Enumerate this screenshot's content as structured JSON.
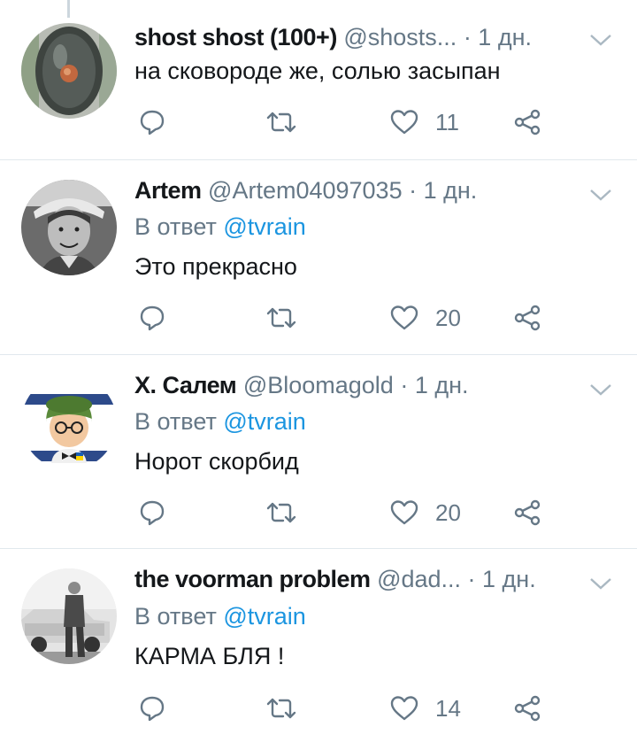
{
  "tweets": [
    {
      "name": "shost shost (100+)",
      "handle": "@shosts...",
      "time": "· 1 дн.",
      "reply_prefix": "",
      "reply_mention": "",
      "text": "на сковороде же, солью засыпан",
      "reply_count": "",
      "retweet_count": "",
      "like_count": "11"
    },
    {
      "name": "Artem",
      "handle": "@Artem04097035",
      "time": "· 1 дн.",
      "reply_prefix": "В ответ ",
      "reply_mention": "@tvrain",
      "text": "Это прекрасно",
      "reply_count": "",
      "retweet_count": "",
      "like_count": "20"
    },
    {
      "name": "Х. Салем",
      "handle": "@Bloomagold",
      "time": "· 1 дн.",
      "reply_prefix": "В ответ ",
      "reply_mention": "@tvrain",
      "text": "Норот скорбид",
      "reply_count": "",
      "retweet_count": "",
      "like_count": "20"
    },
    {
      "name": "the voorman problem",
      "handle": "@dad...",
      "time": "· 1 дн.",
      "reply_prefix": "В ответ ",
      "reply_mention": "@tvrain",
      "text": "КАРМА БЛЯ !",
      "reply_count": "",
      "retweet_count": "",
      "like_count": "14"
    }
  ],
  "colors": {
    "text": "#14171a",
    "secondary": "#657786",
    "link": "#1b95e0",
    "divider": "#e1e8ed"
  },
  "icons": [
    "reply-icon",
    "retweet-icon",
    "like-icon",
    "share-icon",
    "chevron-down-icon"
  ]
}
